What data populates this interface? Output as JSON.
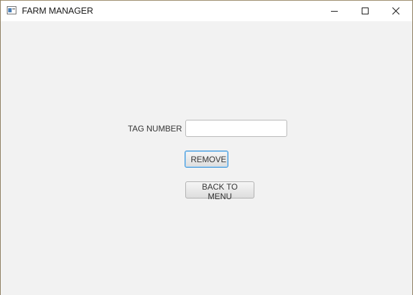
{
  "window": {
    "title": "FARM MANAGER",
    "icon": "app-window-icon",
    "controls": [
      "minimize-icon",
      "maximize-icon",
      "close-icon"
    ]
  },
  "form": {
    "tag_label": "TAG NUMBER",
    "tag_value": "",
    "tag_placeholder": "",
    "remove_label": "REMOVE",
    "back_label": "BACK TO MENU"
  },
  "colors": {
    "background": "#f2f2f2",
    "titlebar": "#ffffff",
    "focus_border": "#3a93d8"
  }
}
